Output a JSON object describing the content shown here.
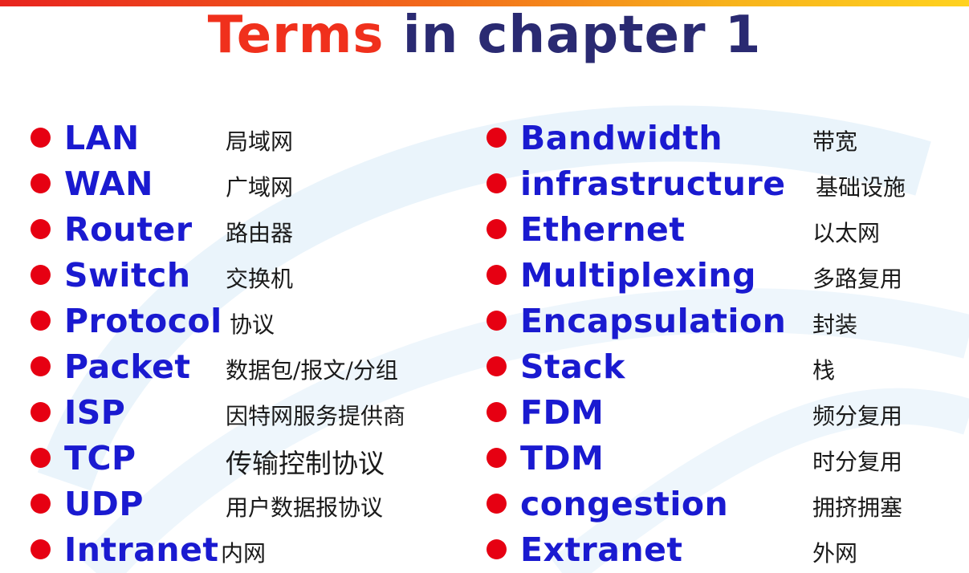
{
  "title": {
    "part1": "Terms",
    "part2": "in chapter 1"
  },
  "colors": {
    "bullet": "#e60012",
    "term": "#1a1ad0",
    "title_accent": "#f0301c",
    "title_main": "#2a2a72"
  },
  "left_terms": [
    {
      "en": "LAN",
      "zh": "局域网"
    },
    {
      "en": "WAN",
      "zh": "广域网"
    },
    {
      "en": "Router",
      "zh": "路由器"
    },
    {
      "en": "Switch",
      "zh": "交换机"
    },
    {
      "en": "Protocol",
      "zh": "协议"
    },
    {
      "en": "Packet",
      "zh": "数据包/报文/分组"
    },
    {
      "en": "ISP",
      "zh": "因特网服务提供商"
    },
    {
      "en": "TCP",
      "zh": "传输控制协议"
    },
    {
      "en": "UDP",
      "zh": "用户数据报协议"
    },
    {
      "en": "Intranet",
      "zh": "内网"
    }
  ],
  "right_terms": [
    {
      "en": "Bandwidth",
      "zh": "带宽"
    },
    {
      "en": "infrastructure",
      "zh": "基础设施"
    },
    {
      "en": "Ethernet",
      "zh": "以太网"
    },
    {
      "en": "Multiplexing",
      "zh": "多路复用"
    },
    {
      "en": "Encapsulation",
      "zh": "封装"
    },
    {
      "en": "Stack",
      "zh": "栈"
    },
    {
      "en": "FDM",
      "zh": "频分复用"
    },
    {
      "en": "TDM",
      "zh": "时分复用"
    },
    {
      "en": "congestion",
      "zh": "拥挤拥塞"
    },
    {
      "en": "Extranet",
      "zh": "外网"
    }
  ]
}
